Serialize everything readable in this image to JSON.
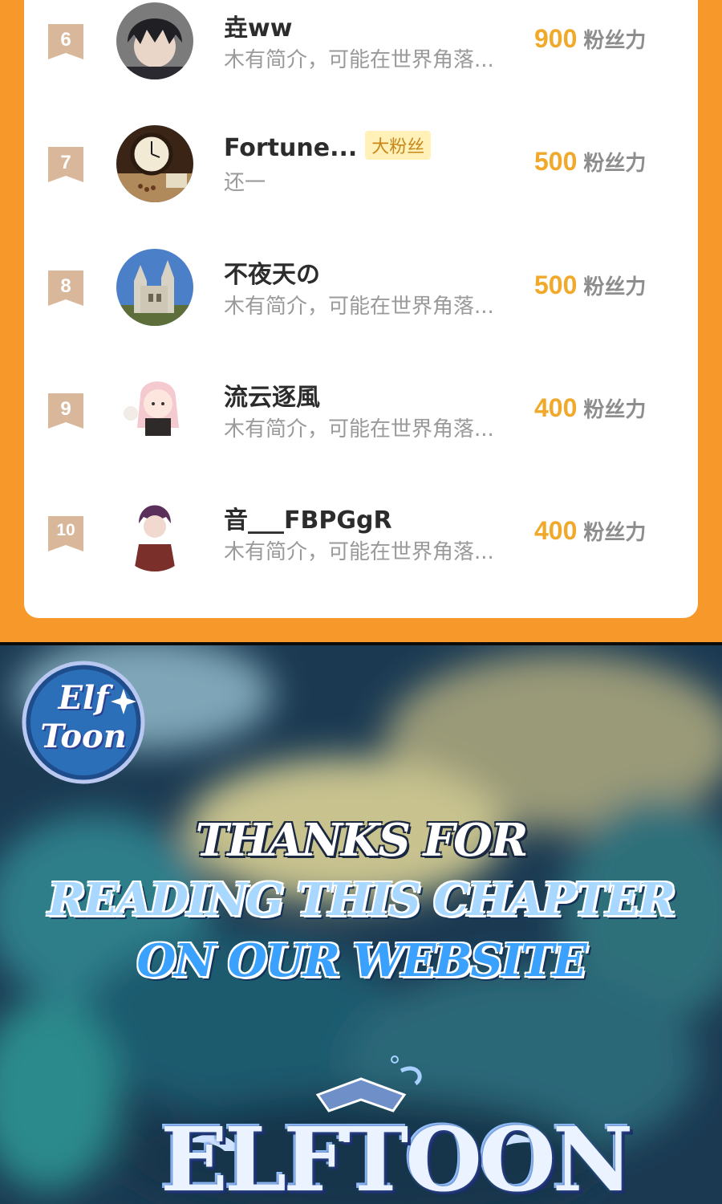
{
  "ranking": {
    "rows": [
      {
        "rank": "6",
        "name": "垚ww",
        "badge": "",
        "intro": "木有简介，可能在世界角落...",
        "score": "900",
        "unit": "粉丝力",
        "avatar": "dark-hair-boy-avatar"
      },
      {
        "rank": "7",
        "name": "Fortune...",
        "badge": "大粉丝",
        "intro": "还一",
        "score": "500",
        "unit": "粉丝力",
        "avatar": "clock-avatar"
      },
      {
        "rank": "8",
        "name": "不夜天の",
        "badge": "",
        "intro": "木有简介，可能在世界角落...",
        "score": "500",
        "unit": "粉丝力",
        "avatar": "cathedral-avatar"
      },
      {
        "rank": "9",
        "name": "流云逐風",
        "badge": "",
        "intro": "木有简介，可能在世界角落...",
        "score": "400",
        "unit": "粉丝力",
        "avatar": "anime-girl-avatar"
      },
      {
        "rank": "10",
        "name": "音___FBPGgR",
        "badge": "",
        "intro": "木有简介，可能在世界角落...",
        "score": "400",
        "unit": "粉丝力",
        "avatar": "purple-hair-boy-avatar"
      }
    ]
  },
  "promo": {
    "corner_logo_line1": "Elf",
    "corner_logo_line2": "Toon",
    "thanks_line1": "THANKS FOR",
    "thanks_line2": "READING THIS CHAPTER",
    "thanks_line3": "ON OUR WEBSITE",
    "big_logo": "ELFTOON"
  },
  "colors": {
    "accent_orange": "#f7982a",
    "score_gold": "#f0a92a",
    "badge_tan": "#d9b79a"
  }
}
